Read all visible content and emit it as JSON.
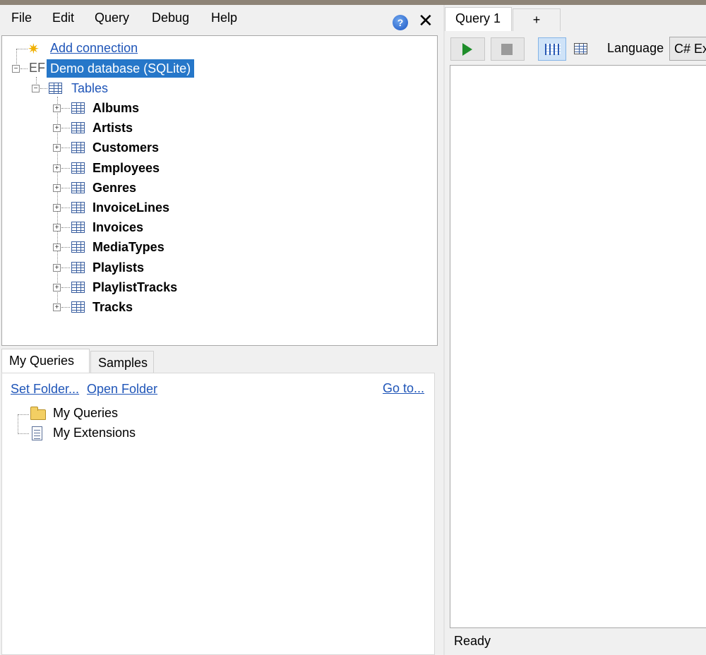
{
  "menu": {
    "file": "File",
    "edit": "Edit",
    "query": "Query",
    "debug": "Debug",
    "help": "Help",
    "help_icon": "?",
    "close_icon": "✕"
  },
  "connections": {
    "add_connection": "Add connection",
    "driver_badge": "EF",
    "database_label": "Demo database (SQLite)",
    "tables_label": "Tables",
    "tables": [
      "Albums",
      "Artists",
      "Customers",
      "Employees",
      "Genres",
      "InvoiceLines",
      "Invoices",
      "MediaTypes",
      "Playlists",
      "PlaylistTracks",
      "Tracks"
    ]
  },
  "bottom_tabs": {
    "my_queries": "My Queries",
    "samples": "Samples"
  },
  "queries_panel": {
    "set_folder": "Set Folder...",
    "open_folder": "Open Folder",
    "go_to": "Go to...",
    "items": [
      "My Queries",
      "My Extensions"
    ]
  },
  "query_tabs": {
    "active": "Query 1",
    "add": "+"
  },
  "toolbar": {
    "language_label": "Language",
    "language_value": "C# Expression"
  },
  "status": "Ready",
  "colors": {
    "selection": "#2677c9",
    "link": "#1f55b8",
    "run_green": "#1e8d2a"
  }
}
